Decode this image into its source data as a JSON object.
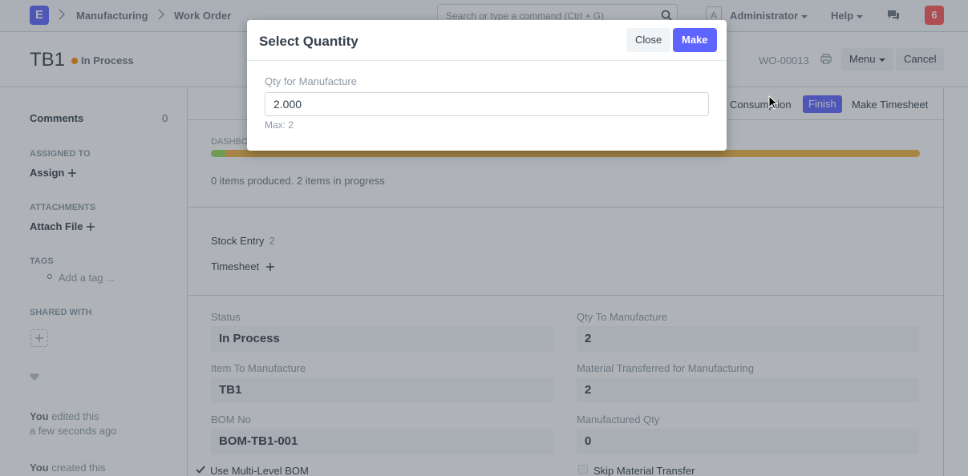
{
  "navbar": {
    "logo_letter": "E",
    "breadcrumbs": [
      "Manufacturing",
      "Work Order"
    ],
    "search_placeholder": "Search or type a command (Ctrl + G)",
    "avatar_letter": "A",
    "user_label": "Administrator",
    "help_label": "Help",
    "notification_count": "6"
  },
  "page": {
    "title": "TB1",
    "status": "In Process",
    "doc_name": "WO-00013",
    "menu_label": "Menu",
    "cancel_label": "Cancel"
  },
  "sidebar": {
    "comments_label": "Comments",
    "comments_count": "0",
    "assigned_to_label": "ASSIGNED TO",
    "assign_label": "Assign",
    "attachments_label": "ATTACHMENTS",
    "attach_file_label": "Attach File",
    "tags_label": "TAGS",
    "add_tag_label": "Add a tag ...",
    "shared_with_label": "SHARED WITH",
    "activity": [
      {
        "actor": "You",
        "text": " edited this",
        "time": "a few seconds ago"
      },
      {
        "actor": "You",
        "text": " created this"
      }
    ]
  },
  "toolbar": {
    "consumption_label": "Consumption",
    "finish_label": "Finish",
    "make_timesheet_label": "Make Timesheet"
  },
  "dashboard": {
    "label": "DASHBOARD",
    "progress_done_fraction": 0.02,
    "progress_text": "0 items produced. 2 items in progress"
  },
  "connections": {
    "stock_entry_label": "Stock Entry",
    "stock_entry_count": "2",
    "timesheet_label": "Timesheet"
  },
  "fields": {
    "status_label": "Status",
    "status_value": "In Process",
    "qty_to_manufacture_label": "Qty To Manufacture",
    "qty_to_manufacture_value": "2",
    "item_label": "Item To Manufacture",
    "item_value": "TB1",
    "material_transferred_label": "Material Transferred for Manufacturing",
    "material_transferred_value": "2",
    "bom_label": "BOM No",
    "bom_value": "BOM-TB1-001",
    "manufactured_qty_label": "Manufactured Qty",
    "manufactured_qty_value": "0",
    "multi_level_bom_label": "Use Multi-Level BOM",
    "skip_material_label": "Skip Material Transfer"
  },
  "modal": {
    "title": "Select Quantity",
    "close_label": "Close",
    "make_label": "Make",
    "field_label": "Qty for Manufacture",
    "field_value": "2.000",
    "help_text": "Max: 2"
  },
  "colors": {
    "primary": "#5e64ff",
    "notification": "#ff5858",
    "status_dot": "#ff8c00",
    "progress_done": "#98d85b",
    "progress_active": "#f0b341"
  }
}
